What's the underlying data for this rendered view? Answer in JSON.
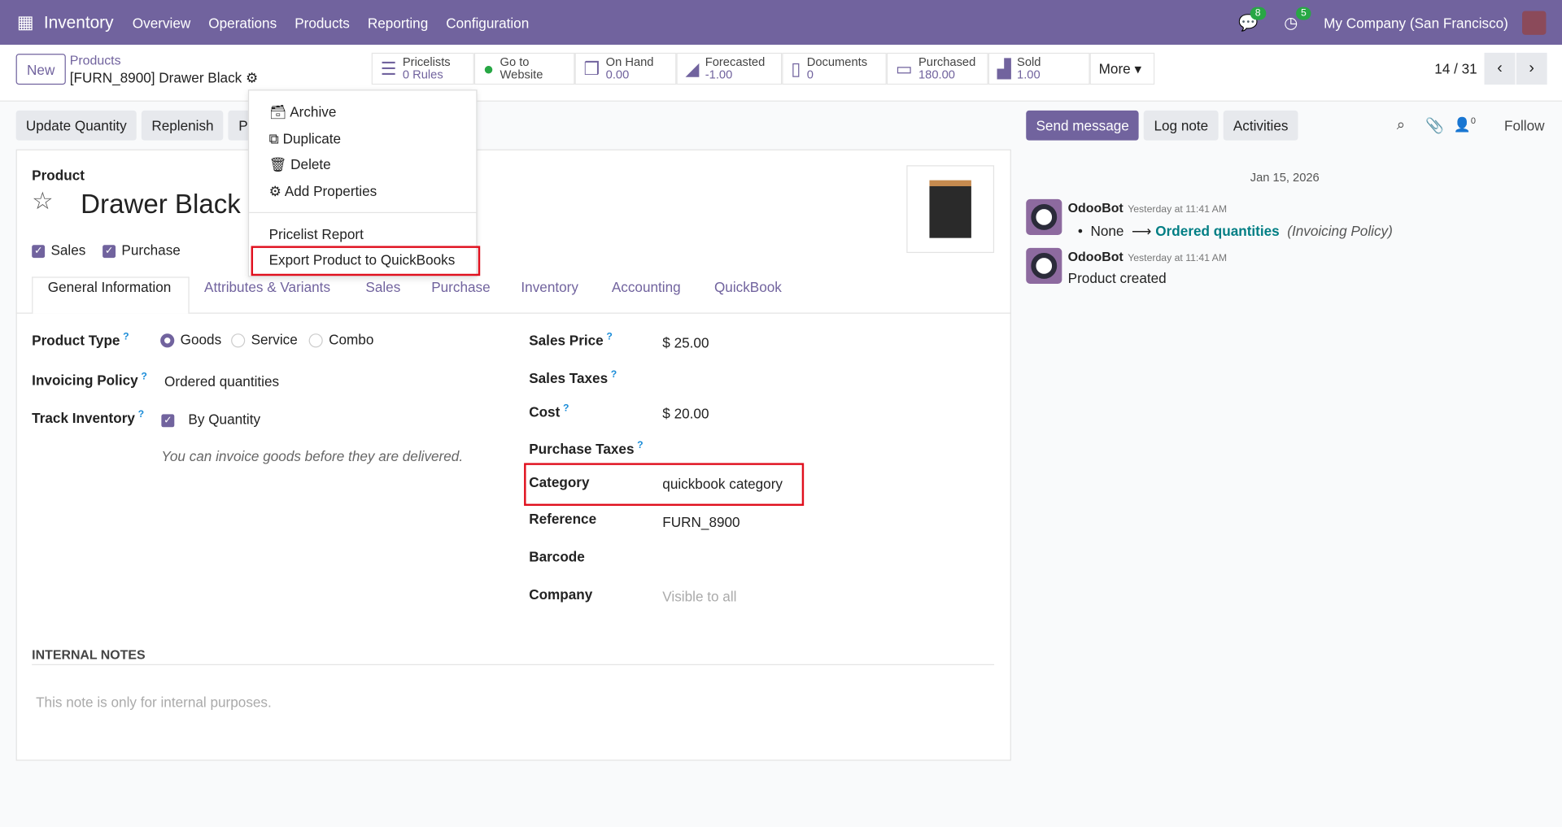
{
  "nav": {
    "app": "Inventory",
    "menu": [
      "Overview",
      "Operations",
      "Products",
      "Reporting",
      "Configuration"
    ],
    "messages_count": "8",
    "activities_count": "5",
    "company": "My Company (San Francisco)"
  },
  "control": {
    "new": "New",
    "breadcrumb_parent": "Products",
    "record": "[FURN_8900] Drawer Black",
    "pager": "14 / 31",
    "more": "More"
  },
  "smart_buttons": [
    {
      "label": "Pricelists",
      "value": "0 Rules",
      "icon": "list-icon"
    },
    {
      "label": "Go to",
      "value": "Website",
      "icon": "globe-icon"
    },
    {
      "label": "On Hand",
      "value": "0.00",
      "icon": "cubes-icon"
    },
    {
      "label": "Forecasted",
      "value": "-1.00",
      "icon": "area-chart-icon"
    },
    {
      "label": "Documents",
      "value": "0",
      "icon": "file-icon"
    },
    {
      "label": "Purchased",
      "value": "180.00",
      "icon": "credit-card-icon"
    },
    {
      "label": "Sold",
      "value": "1.00",
      "icon": "signal-icon"
    }
  ],
  "actions": {
    "update_qty": "Update Quantity",
    "replenish": "Replenish",
    "hidden": "P"
  },
  "gear_menu": {
    "items": [
      "Archive",
      "Duplicate",
      "Delete",
      "Add Properties"
    ],
    "items2": [
      "Pricelist Report",
      "Export Product to QuickBooks"
    ]
  },
  "form": {
    "product_label": "Product",
    "name": "Drawer Black",
    "sales": "Sales",
    "purchase": "Purchase",
    "tabs": [
      "General Information",
      "Attributes & Variants",
      "Sales",
      "Purchase",
      "Inventory",
      "Accounting",
      "QuickBook"
    ],
    "product_type_label": "Product Type",
    "types": [
      "Goods",
      "Service",
      "Combo"
    ],
    "invoicing_label": "Invoicing Policy",
    "invoicing": "Ordered quantities",
    "track_label": "Track Inventory",
    "track": "By Quantity",
    "hint": "You can invoice goods before they are delivered.",
    "sales_price_label": "Sales Price",
    "sales_price": "$ 25.00",
    "sales_taxes_label": "Sales Taxes",
    "cost_label": "Cost",
    "cost": "$ 20.00",
    "purchase_taxes_label": "Purchase Taxes",
    "category_label": "Category",
    "category": "quickbook category",
    "reference_label": "Reference",
    "reference": "FURN_8900",
    "barcode_label": "Barcode",
    "company_label": "Company",
    "company_placeholder": "Visible to all",
    "notes_label": "INTERNAL NOTES",
    "notes_placeholder": "This note is only for internal purposes."
  },
  "chatter": {
    "send": "Send message",
    "log": "Log note",
    "activities": "Activities",
    "followers": "0",
    "follow": "Follow",
    "date": "Jan 15, 2026",
    "messages": [
      {
        "author": "OdooBot",
        "time": "Yesterday at 11:41 AM",
        "old": "None",
        "new": "Ordered quantities",
        "field": "(Invoicing Policy)"
      },
      {
        "author": "OdooBot",
        "time": "Yesterday at 11:41 AM",
        "body": "Product created"
      }
    ]
  }
}
